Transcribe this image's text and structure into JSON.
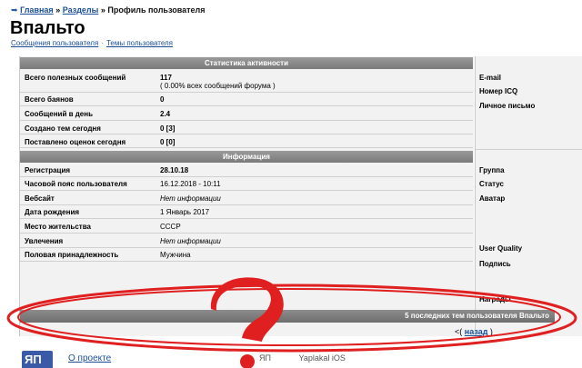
{
  "breadcrumb": {
    "home": "Главная",
    "sections": "Разделы",
    "current": "Профиль пользователя",
    "separator": "»"
  },
  "profile": {
    "username": "Впальто",
    "links": {
      "messages": "Сообщения пользователя",
      "topics": "Темы пользователя",
      "separator": "·"
    }
  },
  "activity": {
    "header": "Статистика активности",
    "rows": [
      {
        "label": "Всего полезных сообщений",
        "value": "117",
        "extra": "( 0.00% всех сообщений форума )"
      },
      {
        "label": "Всего баянов",
        "value": "0"
      },
      {
        "label": "Сообщений в день",
        "value": "2.4"
      },
      {
        "label": "Создано тем сегодня",
        "value": "0 [3]"
      },
      {
        "label": "Поставлено оценок сегодня",
        "value": "0 [0]"
      }
    ]
  },
  "info": {
    "header": "Информация",
    "rows": [
      {
        "label": "Регистрация",
        "value": "28.10.18"
      },
      {
        "label": "Часовой пояс пользователя",
        "value": "16.12.2018 - 10:11"
      },
      {
        "label": "Вебсайт",
        "value": "Нет информации"
      },
      {
        "label": "Дата рождения",
        "value": "1 Январь 2017"
      },
      {
        "label": "Место жительства",
        "value": "СССР"
      },
      {
        "label": "Увлечения",
        "value": "Нет информации"
      },
      {
        "label": "Половая принадлежность",
        "value": "Мужчина"
      }
    ]
  },
  "contact": {
    "email": "E-mail",
    "icq": "Номер ICQ",
    "pm": "Личное письмо"
  },
  "side": {
    "group": "Группа",
    "status": "Статус",
    "avatar": "Аватар",
    "quality": "User Quality",
    "signature": "Подпись",
    "awards": "Награды"
  },
  "recent_topics": {
    "header": "5 последних тем пользователя Впальто",
    "back_open": "<(",
    "back": "назад",
    "back_close": ")"
  },
  "footer": {
    "about": "О проекте",
    "logo": "ЯП",
    "link1": "ЯП",
    "link2": "Yaplakal iOS"
  },
  "colors": {
    "link": "#1a4e98",
    "header_bg": "#8a8a8a",
    "panel_bg": "#f2f2f2",
    "annotation": "#e02020"
  }
}
